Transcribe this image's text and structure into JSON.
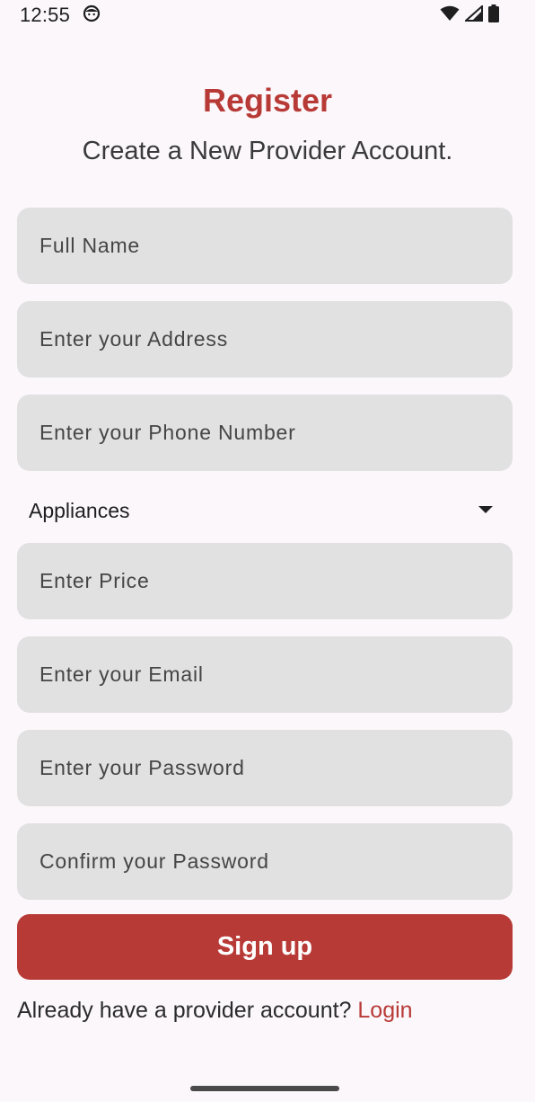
{
  "status_bar": {
    "time": "12:55",
    "app_icon": "android-face-icon",
    "icons": [
      "wifi-icon",
      "cellular-signal-icon",
      "battery-icon"
    ]
  },
  "header": {
    "title": "Register",
    "subtitle": "Create a New Provider Account."
  },
  "form": {
    "full_name": {
      "placeholder": "Full Name",
      "value": ""
    },
    "address": {
      "placeholder": "Enter your Address",
      "value": ""
    },
    "phone": {
      "placeholder": "Enter your Phone Number",
      "value": ""
    },
    "category": {
      "selected": "Appliances",
      "icon": "dropdown-arrow-icon"
    },
    "price": {
      "placeholder": "Enter Price",
      "value": ""
    },
    "email": {
      "placeholder": "Enter your Email",
      "value": ""
    },
    "password": {
      "placeholder": "Enter your Password",
      "value": ""
    },
    "confirm_password": {
      "placeholder": "Confirm your Password",
      "value": ""
    }
  },
  "actions": {
    "signup_label": "Sign up",
    "login_prompt": "Already have a provider account? ",
    "login_label": "Login"
  },
  "colors": {
    "accent": "#b83a36",
    "background": "#fbf7fb",
    "field_background": "#e1e1e1"
  }
}
